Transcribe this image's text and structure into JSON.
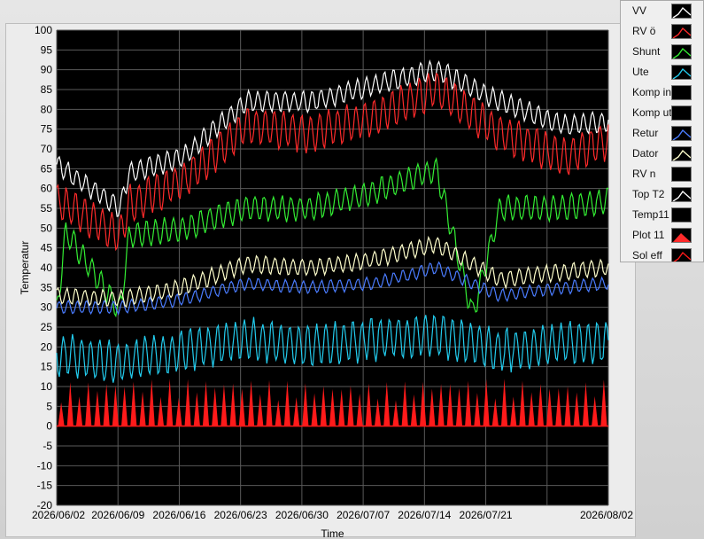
{
  "chart_data": {
    "type": "line",
    "xlabel": "Time",
    "ylabel": "Temperatur",
    "ylim": [
      -20,
      100
    ],
    "y_ticks": [
      -20,
      -15,
      -10,
      -5,
      0,
      5,
      10,
      15,
      20,
      25,
      30,
      35,
      40,
      45,
      50,
      55,
      60,
      65,
      70,
      75,
      80,
      85,
      90,
      95,
      100
    ],
    "x_range": [
      "2026/06/02",
      "2026/08/02"
    ],
    "x_tick_labels": [
      "2026/06/02",
      "2026/06/09",
      "2026/06/16",
      "2026/06/23",
      "2026/06/30",
      "2026/07/07",
      "2026/07/14",
      "2026/07/21",
      "",
      "2026/08/02"
    ],
    "background": "#000000",
    "grid": true,
    "legend_position": "top-right",
    "series": [
      {
        "name": "VV",
        "color": "#ffffff",
        "x": [
          "2026/06/02",
          "2026/06/09",
          "2026/06/10",
          "2026/06/16",
          "2026/06/23",
          "2026/06/30",
          "2026/07/07",
          "2026/07/14",
          "2026/07/21",
          "2026/07/28",
          "2026/08/02"
        ],
        "values": [
          66,
          55,
          64,
          68,
          82,
          82,
          86,
          90,
          82,
          76,
          77
        ]
      },
      {
        "name": "RV ö",
        "color": "#ff2a2a",
        "x": [
          "2026/06/02",
          "2026/06/09",
          "2026/06/10",
          "2026/06/16",
          "2026/06/23",
          "2026/06/30",
          "2026/07/07",
          "2026/07/14",
          "2026/07/21",
          "2026/07/28",
          "2026/08/02"
        ],
        "values": [
          57,
          48,
          56,
          62,
          76,
          74,
          78,
          85,
          74,
          68,
          72
        ]
      },
      {
        "name": "Shunt",
        "color": "#33ee33",
        "x": [
          "2026/06/02",
          "2026/06/03",
          "2026/06/09",
          "2026/06/10",
          "2026/06/16",
          "2026/06/23",
          "2026/06/30",
          "2026/07/07",
          "2026/07/14",
          "2026/07/18",
          "2026/07/21",
          "2026/07/28",
          "2026/08/02"
        ],
        "values": [
          29,
          49,
          29,
          48,
          50,
          55,
          55,
          59,
          65,
          28,
          55,
          55,
          57
        ]
      },
      {
        "name": "Ute",
        "color": "#22ccee",
        "x": [
          "2026/06/02",
          "2026/06/09",
          "2026/06/16",
          "2026/06/23",
          "2026/06/30",
          "2026/07/07",
          "2026/07/14",
          "2026/07/21",
          "2026/07/28",
          "2026/08/02"
        ],
        "values": [
          18,
          16,
          19,
          22,
          20,
          22,
          23,
          19,
          21,
          21
        ]
      },
      {
        "name": "Komp in",
        "color": "#000000",
        "x": [],
        "values": []
      },
      {
        "name": "Komp ut",
        "color": "#000000",
        "x": [],
        "values": []
      },
      {
        "name": "Retur",
        "color": "#4a7cff",
        "x": [
          "2026/06/02",
          "2026/06/09",
          "2026/06/16",
          "2026/06/23",
          "2026/06/30",
          "2026/07/07",
          "2026/07/14",
          "2026/07/21",
          "2026/07/28",
          "2026/08/02"
        ],
        "values": [
          30,
          30,
          32,
          36,
          35,
          36,
          40,
          33,
          35,
          36
        ]
      },
      {
        "name": "Dator",
        "color": "#ffffcc",
        "x": [
          "2026/06/02",
          "2026/06/09",
          "2026/06/16",
          "2026/06/23",
          "2026/06/30",
          "2026/07/07",
          "2026/07/14",
          "2026/07/21",
          "2026/07/28",
          "2026/08/02"
        ],
        "values": [
          33,
          32,
          35,
          41,
          40,
          42,
          46,
          37,
          39,
          40
        ]
      },
      {
        "name": "RV n",
        "color": "#000000",
        "x": [],
        "values": []
      },
      {
        "name": "Top T2",
        "color": "#ffffff",
        "x": [],
        "values": []
      },
      {
        "name": "Temp11",
        "color": "#000000",
        "x": [],
        "values": []
      },
      {
        "name": "Plot 11",
        "color": "#ff2a2a",
        "x": [],
        "values": []
      },
      {
        "name": "Sol eff",
        "color": "#ff1a1a",
        "x": [
          "2026/06/02",
          "2026/06/09",
          "2026/06/16",
          "2026/06/23",
          "2026/06/30",
          "2026/07/07",
          "2026/07/14",
          "2026/07/21",
          "2026/07/28",
          "2026/08/02"
        ],
        "values": [
          11,
          12,
          12,
          12,
          11,
          11,
          12,
          12,
          11,
          12
        ]
      }
    ]
  },
  "legend": {
    "items": [
      {
        "label": "VV",
        "color": "#ffffff",
        "style": "line"
      },
      {
        "label": "RV ö",
        "color": "#ff2a2a",
        "style": "line"
      },
      {
        "label": "Shunt",
        "color": "#33ee33",
        "style": "line"
      },
      {
        "label": "Ute",
        "color": "#22ccee",
        "style": "line"
      },
      {
        "label": "Komp in",
        "color": "#000000",
        "style": "none"
      },
      {
        "label": "Komp ut",
        "color": "#000000",
        "style": "none"
      },
      {
        "label": "Retur",
        "color": "#4a7cff",
        "style": "line"
      },
      {
        "label": "Dator",
        "color": "#ffffcc",
        "style": "line"
      },
      {
        "label": "RV n",
        "color": "#000000",
        "style": "none"
      },
      {
        "label": "Top T2",
        "color": "#ffffff",
        "style": "line"
      },
      {
        "label": "Temp11",
        "color": "#000000",
        "style": "none"
      },
      {
        "label": "Plot 11",
        "color": "#ff2a2a",
        "style": "fill"
      },
      {
        "label": "Sol eff",
        "color": "#ff1a1a",
        "style": "line"
      }
    ]
  }
}
